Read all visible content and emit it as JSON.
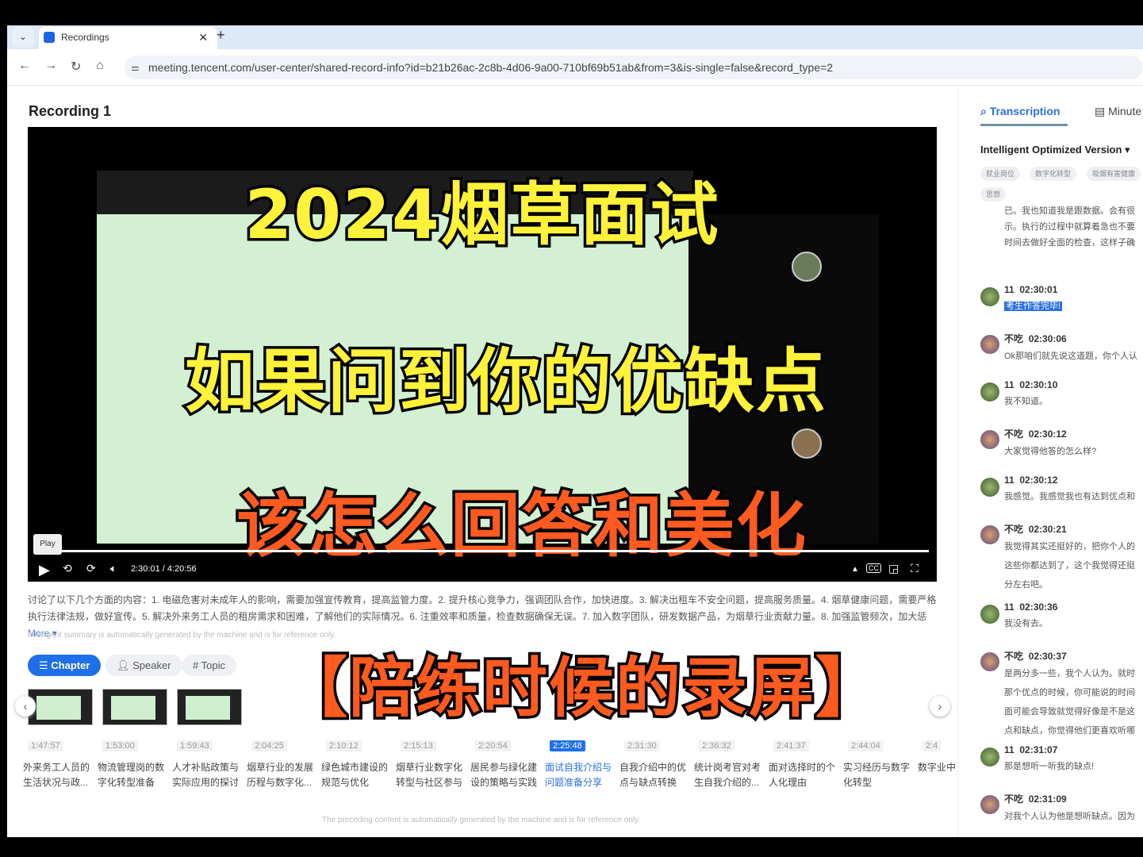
{
  "browser": {
    "tab_title": "Recordings",
    "url": "meeting.tencent.com/user-center/shared-record-info?id=b21b26ac-2c8b-4d06-9a00-710bf69b51ab&from=3&is-single=false&record_type=2"
  },
  "page": {
    "title": "Recording 1"
  },
  "video": {
    "overlay_lines": [
      "2024烟草面试",
      "如果问到你的优缺点",
      "该怎么回答和美化",
      "【陪练时候的录屏】"
    ],
    "overlay_colors": [
      "#fff23a",
      "#fff23a",
      "#ff5a1f",
      "#ff5a1f"
    ],
    "play_tooltip": "Play",
    "time": "2:30:01 / 4:20:56",
    "progress_fraction": 0.576,
    "cc_label": "CC"
  },
  "summary": {
    "text": "讨论了以下几个方面的内容：1. 电磁危害对未成年人的影响，需要加强宣传教育，提高监管力度。2. 提升核心竞争力，强调团队合作，加快进度。3. 解决出租车不安全问题，提高服务质量。4. 烟草健康问题，需要严格执行法律法规，做好宣传。5. 解决外来务工人员的租房需求和困难，了解他们的实际情况。6. 注重效率和质量，检查数据确保无误。7. 加入数字团队，研发数据产品，为烟草行业贡献力量。8. 加强监管频次，加大惩",
    "more": "More ▾",
    "note": "Intelligent summary is automatically generated by the machine and is for reference only."
  },
  "filters": [
    {
      "label": "Chapter",
      "icon": "list-icon"
    },
    {
      "label": "Speaker",
      "icon": "person-icon"
    },
    {
      "label": "Topic",
      "icon": "hash-icon"
    }
  ],
  "chapters": [
    {
      "time": "1:47:57",
      "title": "外来务工人员的生活状况与政..."
    },
    {
      "time": "1:53:00",
      "title": "物流管理岗的数字化转型准备"
    },
    {
      "time": "1:59:43",
      "title": "人才补贴政策与实际应用的探讨"
    },
    {
      "time": "2:04:25",
      "title": "烟草行业的发展历程与数字化..."
    },
    {
      "time": "2:10:12",
      "title": "绿色城市建设的规范与优化"
    },
    {
      "time": "2:15:13",
      "title": "烟草行业数字化转型与社区参与"
    },
    {
      "time": "2:20:54",
      "title": "居民参与绿化建设的策略与实践"
    },
    {
      "time": "2:25:48",
      "title": "面试自我介绍与问题准备分享",
      "active": true
    },
    {
      "time": "2:31:30",
      "title": "自我介绍中的优点与缺点转换"
    },
    {
      "time": "2:36:32",
      "title": "统计岗考官对考生自我介绍的..."
    },
    {
      "time": "2:41:37",
      "title": "面对选择时的个人化理由"
    },
    {
      "time": "2:44:04",
      "title": "实习经历与数字化转型"
    },
    {
      "time": "2:4",
      "title": "数字业中"
    }
  ],
  "footer": "The preceding content is automatically generated by the machine and is for reference only.",
  "right_panel": {
    "tabs": [
      "Transcription",
      "Minute"
    ],
    "version": "Intelligent Optimized Version ▾",
    "tags": [
      "就业岗位",
      "数字化转型",
      "吸烟有害健康",
      "思想"
    ],
    "preview": [
      "已。我也知道我是跟数据。会有很",
      "示。执行的过程中就算着急也不要",
      "时间去做好全面的检查，这样子确"
    ],
    "messages": [
      {
        "speaker": "11",
        "time": "02:30:01",
        "text": [
          "考生作答完毕!"
        ],
        "highlight": true
      },
      {
        "speaker": "不吃",
        "time": "02:30:06",
        "text": [
          "Ok那咱们就先说这道题，你个人认"
        ]
      },
      {
        "speaker": "11",
        "time": "02:30:10",
        "text": [
          "我不知道。"
        ]
      },
      {
        "speaker": "不吃",
        "time": "02:30:12",
        "text": [
          "大家觉得他答的怎么样?"
        ]
      },
      {
        "speaker": "11",
        "time": "02:30:12",
        "text": [
          "我感觉。我感觉我也有达到优点和"
        ]
      },
      {
        "speaker": "不吃",
        "time": "02:30:21",
        "text": [
          "我觉得其实还挺好的，把你个人的",
          "这些你都达到了，这个我觉得还挺",
          "分左右吧。"
        ]
      },
      {
        "speaker": "11",
        "time": "02:30:36",
        "text": [
          "我没有去。"
        ]
      },
      {
        "speaker": "不吃",
        "time": "02:30:37",
        "text": [
          "是两分多一些，我个人认为。就时",
          "那个优点的时候，你可能说的时间",
          "面可能会导致就觉得好像是不是这",
          "点和缺点，你觉得他们更喜欢听哪"
        ]
      },
      {
        "speaker": "11",
        "time": "02:31:07",
        "text": [
          "那是想听一听我的缺点!"
        ]
      },
      {
        "speaker": "不吃",
        "time": "02:31:09",
        "text": [
          "对我个人认为他是想听缺点。因为"
        ]
      }
    ]
  }
}
